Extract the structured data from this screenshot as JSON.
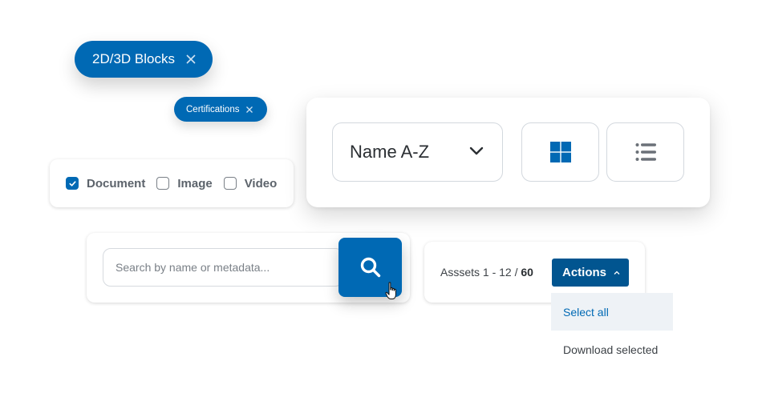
{
  "filters": {
    "chips": [
      {
        "label": "2D/3D Blocks",
        "close_icon": "close-icon"
      },
      {
        "label": "Certifications",
        "close_icon": "close-icon"
      }
    ],
    "types": [
      {
        "label": "Document",
        "checked": true
      },
      {
        "label": "Image",
        "checked": false
      },
      {
        "label": "Video",
        "checked": false
      }
    ]
  },
  "sort": {
    "selected": "Name A-Z",
    "dropdown_icon": "chevron-down-icon",
    "views": [
      {
        "name": "grid-view",
        "icon": "grid-icon",
        "active": true
      },
      {
        "name": "list-view",
        "icon": "list-icon",
        "active": false
      }
    ]
  },
  "search": {
    "placeholder": "Search by name or metadata...",
    "value": "",
    "button_icon": "search-icon"
  },
  "assets": {
    "label": "Asssets 1 - 12 / ",
    "total": "60",
    "actions_label": "Actions",
    "actions_icon": "chevron-up-icon",
    "menu": [
      {
        "label": "Select all",
        "highlighted": true
      },
      {
        "label": "Download selected",
        "highlighted": false
      }
    ]
  },
  "colors": {
    "primary": "#0069b4",
    "actions_bg": "#015590",
    "menu_highlight": "#eef2f6"
  }
}
